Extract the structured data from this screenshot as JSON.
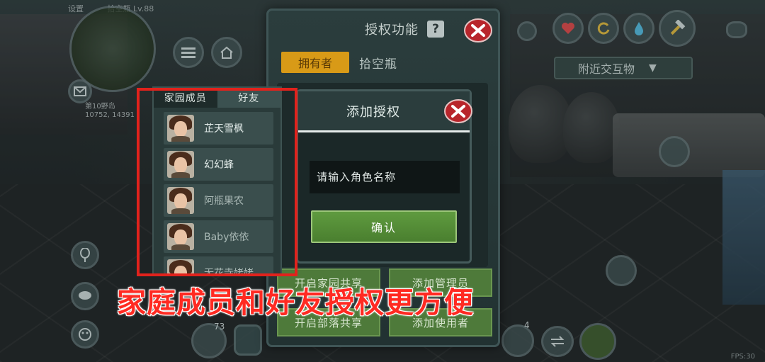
{
  "hud": {
    "top_left_label": "设置",
    "top_mid_label": "拾空瓶 Lv.88",
    "map_label_line1": "第10野岛",
    "map_coords": "10752, 14391",
    "nearby_interact": "附近交互物",
    "chat_badge": "73",
    "bag_badge": "4",
    "bottom_time": "FPS:30"
  },
  "auth_panel": {
    "title": "授权功能",
    "help_symbol": "?",
    "owner_tag": "拥有者",
    "owner_name": "拾空瓶",
    "buttons": {
      "share_home": "开启家园共享",
      "add_manager": "添加管理员",
      "share_tribe": "开启部落共享",
      "add_user": "添加使用者"
    }
  },
  "member_panel": {
    "tabs": [
      "家园成员",
      "好友"
    ],
    "members": [
      {
        "name": "芷天雪枫"
      },
      {
        "name": "幻幻蜂"
      },
      {
        "name": "阿瓶果农"
      },
      {
        "name": "Baby依依"
      },
      {
        "name": "无花寺姥姥"
      }
    ]
  },
  "add_dialog": {
    "title": "添加授权",
    "input_placeholder": "请输入角色名称",
    "confirm_label": "确认"
  },
  "caption": "家庭成员和好友授权更方便",
  "colors": {
    "accent_red": "#e2221c",
    "confirm_green": "#5f9b3f",
    "owner_gold": "#d89a17",
    "close_red": "#b8252b"
  }
}
